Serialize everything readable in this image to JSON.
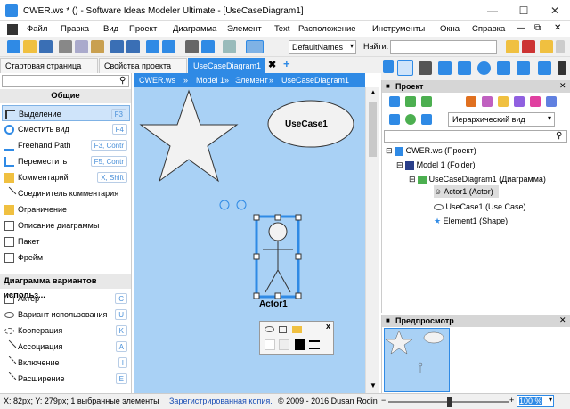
{
  "title": "CWER.ws * () - Software Ideas Modeler Ultimate - [UseCaseDiagram1]",
  "menu": [
    "Файл",
    "Правка",
    "Вид",
    "Проект",
    "Диаграмма",
    "Элемент",
    "Text",
    "Расположение",
    "Инструменты",
    "Окна",
    "Справка"
  ],
  "toolbar": {
    "style_value": "DefaultNames",
    "find_label": "Найти:"
  },
  "tabs": [
    "Стартовая страница",
    "Свойства проекта",
    "UseCaseDiagram1"
  ],
  "breadcrumb": [
    "CWER.ws",
    "Model 1",
    "Элемент",
    "UseCaseDiagram1"
  ],
  "left": {
    "general_title": "Общие",
    "general_tools": [
      {
        "label": "Выделение",
        "shortcut": "F3",
        "icon": "cursor-icon"
      },
      {
        "label": "Сместить вид",
        "shortcut": "F4",
        "icon": "pan-icon"
      },
      {
        "label": "Freehand Path",
        "shortcut": "F3, Contr",
        "icon": "freehand-icon"
      },
      {
        "label": "Переместить",
        "shortcut": "F5, Contr",
        "icon": "move-icon"
      },
      {
        "label": "Комментарий",
        "shortcut": "X, Shift",
        "icon": "comment-icon"
      },
      {
        "label": "Соединитель комментария",
        "shortcut": "",
        "icon": "connector-icon"
      },
      {
        "label": "Ограничение",
        "shortcut": "",
        "icon": "constraint-icon"
      },
      {
        "label": "Описание диаграммы",
        "shortcut": "",
        "icon": "diagram-desc-icon"
      },
      {
        "label": "Пакет",
        "shortcut": "",
        "icon": "package-icon"
      },
      {
        "label": "Фрейм",
        "shortcut": "",
        "icon": "frame-icon"
      }
    ],
    "usecase_title": "Диаграмма вариантов использ...",
    "usecase_tools": [
      {
        "label": "Актёр",
        "shortcut": "C",
        "icon": "actor-icon"
      },
      {
        "label": "Вариант использования",
        "shortcut": "U",
        "icon": "usecase-icon"
      },
      {
        "label": "Кооперация",
        "shortcut": "K",
        "icon": "collaboration-icon"
      },
      {
        "label": "Ассоциация",
        "shortcut": "A",
        "icon": "association-icon"
      },
      {
        "label": "Включение",
        "shortcut": "I",
        "icon": "include-icon"
      },
      {
        "label": "Расширение",
        "shortcut": "E",
        "icon": "extend-icon"
      }
    ]
  },
  "diagram": {
    "usecase_label": "UseCase1",
    "actor_label": "Actor1",
    "popup_close": "x"
  },
  "project": {
    "title": "Проект",
    "view_select": "Иерархический вид",
    "tree": [
      {
        "label": "CWER.ws (Проект)",
        "icon": "project-icon"
      },
      {
        "label": "Model 1 (Folder)",
        "icon": "folder-icon"
      },
      {
        "label": "UseCaseDiagram1 (Диаграмма)",
        "icon": "diagram-icon"
      },
      {
        "label": "Actor1 (Actor)",
        "icon": "actor-icon"
      },
      {
        "label": "UseCase1 (Use Case)",
        "icon": "usecase-icon"
      },
      {
        "label": "Element1 (Shape)",
        "icon": "shape-icon"
      }
    ]
  },
  "preview": {
    "title": "Предпросмотр"
  },
  "status": {
    "coords": "X: 82px; Y: 279px; 1 выбранные элементы",
    "registered": "Зарегистрированная копия.",
    "copyright": "© 2009 - 2016 Dusan Rodin",
    "zoom": "100 %"
  },
  "colors": {
    "accent": "#2f8ae5",
    "canvas": "#a9d1f5",
    "selection": "#2f8ae5"
  }
}
